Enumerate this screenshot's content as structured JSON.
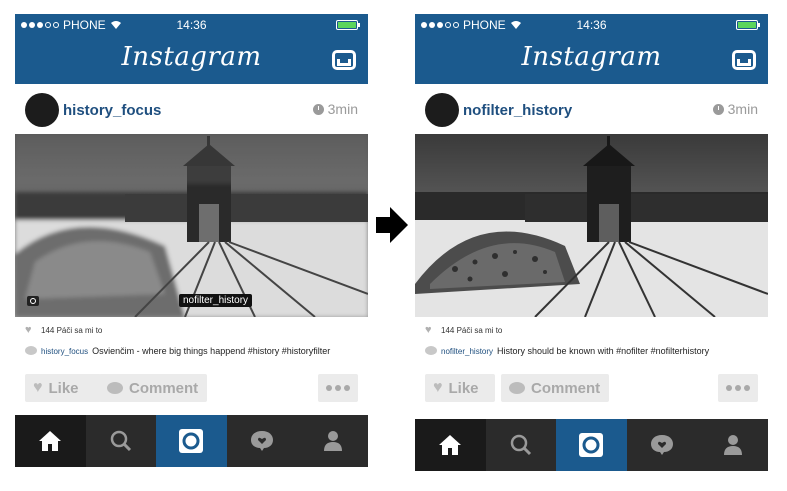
{
  "phones": [
    {
      "status": {
        "carrier": "PHONE",
        "time": "14:36"
      },
      "header": {
        "logo": "Instagram",
        "inbox_icon": "inbox-icon"
      },
      "post": {
        "username": "history_focus",
        "time_ago": "3min",
        "photo_tag": "nofilter_history",
        "photo_style": "tilt-shift blurred, bright",
        "likes_text": "144 Páči sa mi to",
        "caption_user": "history_focus",
        "caption_text": "Osvienčim - where big things happend #history #historyfilter"
      },
      "actions": {
        "like": "Like",
        "comment": "Comment"
      }
    },
    {
      "status": {
        "carrier": "PHONE",
        "time": "14:36"
      },
      "header": {
        "logo": "Instagram",
        "inbox_icon": "inbox-icon"
      },
      "post": {
        "username": "nofilter_history",
        "time_ago": "3min",
        "photo_style": "unfiltered, high contrast",
        "likes_text": "144 Páči sa mi to",
        "caption_user": "nofilter_history",
        "caption_text": "History should be known with #nofilter #nofilterhistory"
      },
      "actions": {
        "like": "Like",
        "comment": "Comment"
      }
    }
  ],
  "tabs": [
    "home-icon",
    "search-icon",
    "camera-icon",
    "activity-icon",
    "profile-icon"
  ],
  "colors": {
    "header_blue": "#1b5a8e",
    "tabbar": "#2b2b2b",
    "username_blue": "#1f4f7f",
    "battery_green": "#5cd65c"
  }
}
